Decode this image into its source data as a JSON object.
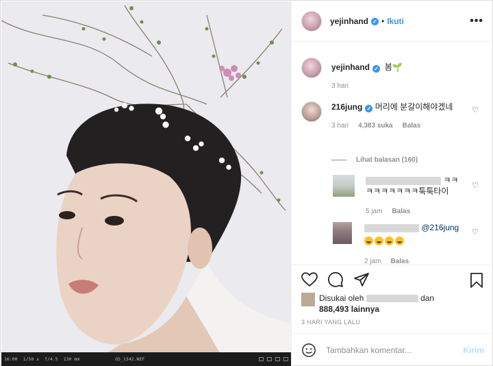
{
  "post": {
    "photo_overlay": {
      "items": [
        "16:00",
        "1/50 s",
        "f/4.5",
        "130 mm",
        "GS_1342.NEF"
      ]
    }
  },
  "header": {
    "username": "yejinhand",
    "follow_label": "Ikuti",
    "more_glyph": "•••",
    "dot": "•"
  },
  "caption": {
    "username": "yejinhand",
    "text": "봄",
    "emoji": "🌱",
    "time": "3 hari"
  },
  "comments": [
    {
      "username": "216jung",
      "text": "머리에 분갈이해야겠네",
      "time": "3 hari",
      "likes": "4,383 suka",
      "reply_label": "Balas",
      "view_replies": "Lihat balasan (160)"
    }
  ],
  "replies": [
    {
      "text_line1": "ㅋㅋ",
      "text_line2": "ㅋㅋㅋㅋㅋㅋㅋ툭툭타이",
      "time": "5 jam",
      "reply_label": "Balas"
    },
    {
      "mention": "@216jung",
      "emoji_count": 4,
      "time": "2 jam",
      "reply_label": "Balas"
    }
  ],
  "likes": {
    "prefix": "Disukai oleh",
    "conjunction": "dan",
    "count": "888,493",
    "suffix": "lainnya"
  },
  "timestamp": "3 HARI YANG LALU",
  "compose": {
    "placeholder": "Tambahkan komentar...",
    "post_label": "Kirim"
  },
  "icons": {
    "like": "heart-icon",
    "comment": "comment-icon",
    "share": "share-icon",
    "save": "bookmark-icon",
    "emoji": "smiley-icon"
  },
  "colors": {
    "accent": "#3897f0",
    "muted": "#8e8e8e",
    "post_disabled": "#b2dffc"
  }
}
